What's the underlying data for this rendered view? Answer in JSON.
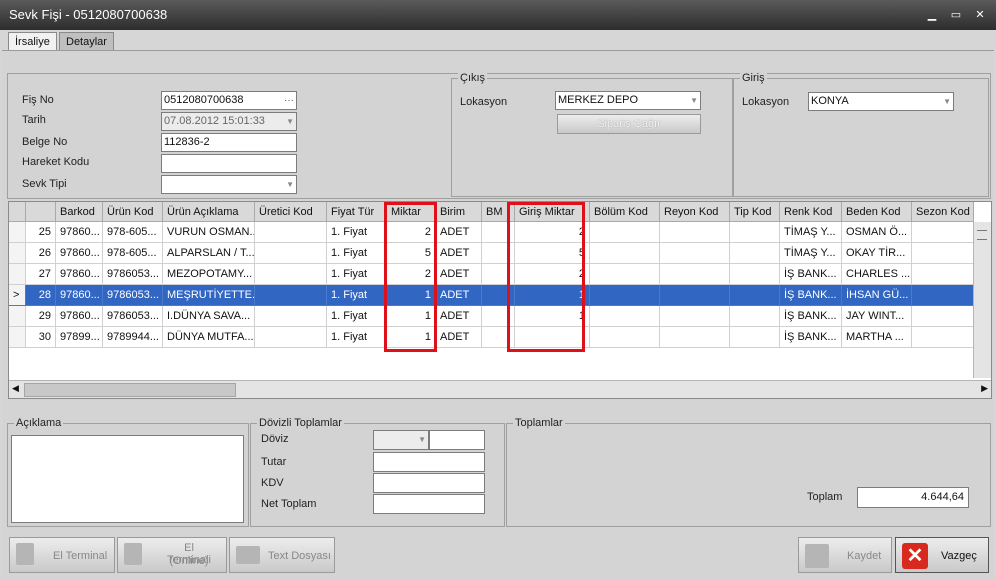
{
  "window": {
    "title": "Sevk Fişi - 0512080700638"
  },
  "tabs": [
    {
      "label": "İrsaliye"
    },
    {
      "label": "Detaylar"
    }
  ],
  "header": {
    "fis_no_label": "Fiş No",
    "fis_no_value": "0512080700638",
    "fis_no_ellipsis": "···",
    "tarih_label": "Tarih",
    "tarih_value": "07.08.2012 15:01:33",
    "belge_no_label": "Belge No",
    "belge_no_value": "112836-2",
    "hareket_kodu_label": "Hareket Kodu",
    "hareket_kodu_value": "",
    "sevk_tipi_label": "Sevk Tipi",
    "sevk_tipi_value": ""
  },
  "cikis": {
    "title": "Çıkış",
    "lokasyon_label": "Lokasyon",
    "lokasyon_value": "MERKEZ DEPO",
    "siparis_button": "Sipariş Çağır"
  },
  "giris": {
    "title": "Giriş",
    "lokasyon_label": "Lokasyon",
    "lokasyon_value": "KONYA"
  },
  "grid": {
    "columns": [
      "",
      "",
      "Barkod",
      "Ürün Kod",
      "Ürün Açıklama",
      "Üretici Kod",
      "Fiyat Tür",
      "Miktar",
      "Birim",
      "BM",
      "Giriş Miktar",
      "Bölüm Kod",
      "Reyon Kod",
      "Tip Kod",
      "Renk Kod",
      "Beden Kod",
      "Sezon Kod"
    ],
    "rows": [
      [
        "",
        "25",
        "97860...",
        "978-605...",
        "VURUN OSMAN...",
        "",
        "1. Fiyat",
        "2",
        "ADET",
        "",
        "2",
        "",
        "",
        "",
        "TİMAŞ Y...",
        "OSMAN Ö...",
        ""
      ],
      [
        "",
        "26",
        "97860...",
        "978-605...",
        "ALPARSLAN / T...",
        "",
        "1. Fiyat",
        "5",
        "ADET",
        "",
        "5",
        "",
        "",
        "",
        "TİMAŞ Y...",
        "OKAY TİR...",
        ""
      ],
      [
        "",
        "27",
        "97860...",
        "9786053...",
        "MEZOPOTAMY...",
        "",
        "1. Fiyat",
        "2",
        "ADET",
        "",
        "2",
        "",
        "",
        "",
        "İŞ BANK...",
        "CHARLES ...",
        ""
      ],
      [
        ">",
        "28",
        "97860...",
        "9786053...",
        "MEŞRUTİYETTE...",
        "",
        "1. Fiyat",
        "1",
        "ADET",
        "",
        "1",
        "",
        "",
        "",
        "İŞ BANK...",
        "İHSAN GÜ...",
        ""
      ],
      [
        "",
        "29",
        "97860...",
        "9786053...",
        "I.DÜNYA SAVA...",
        "",
        "1. Fiyat",
        "1",
        "ADET",
        "",
        "1",
        "",
        "",
        "",
        "İŞ BANK...",
        "JAY WINT...",
        ""
      ],
      [
        "",
        "30",
        "97899...",
        "9789944...",
        "DÜNYA MUTFA...",
        "",
        "1. Fiyat",
        "1",
        "ADET",
        "",
        "",
        "",
        "",
        "",
        "İŞ BANK...",
        "MARTHA ...",
        ""
      ]
    ],
    "selected_row_index": 3
  },
  "aciklama": {
    "title": "Açıklama",
    "value": ""
  },
  "dovizli": {
    "title": "Dövizli Toplamlar",
    "doviz_label": "Döviz",
    "tutar_label": "Tutar",
    "kdv_label": "KDV",
    "net_toplam_label": "Net Toplam"
  },
  "toplamlar": {
    "title": "Toplamlar",
    "toplam_label": "Toplam",
    "toplam_value": "4.644,64"
  },
  "footer": {
    "el_terminal": "El Terminal",
    "el_terminali_online_1": "El Terminali",
    "el_terminali_online_2": "(Online)",
    "text_dosyasi": "Text Dosyası",
    "kaydet": "Kaydet",
    "vazgec": "Vazgeç"
  },
  "colors": {
    "selection": "#3166c2",
    "highlight_box": "#e0101a",
    "titlebar": "#3a3a3a"
  }
}
